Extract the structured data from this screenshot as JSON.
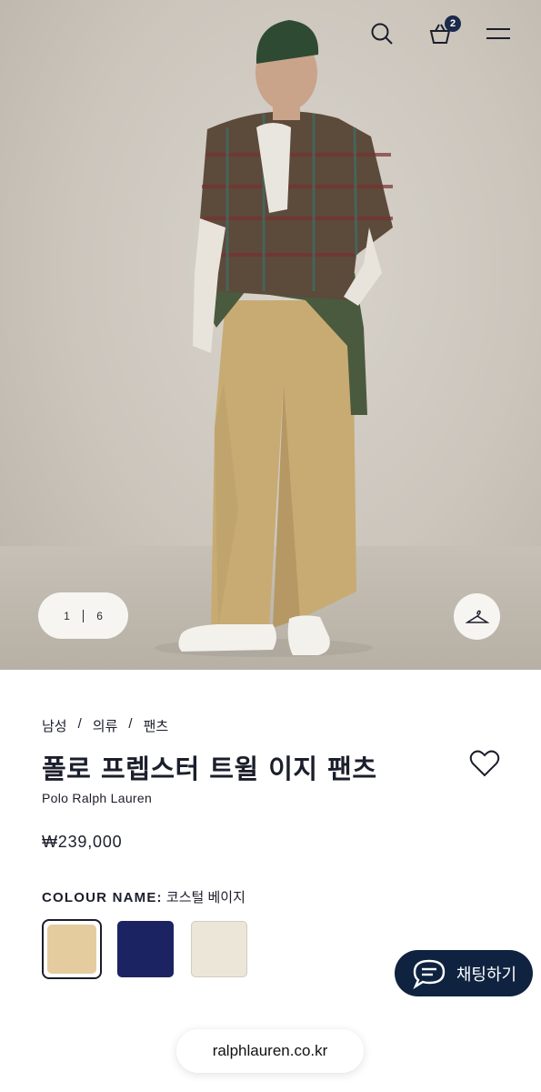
{
  "header": {
    "cart_count": "2"
  },
  "gallery": {
    "current": "1",
    "total": "6"
  },
  "breadcrumb": [
    "남성",
    "의류",
    "팬츠"
  ],
  "product": {
    "title": "폴로 프렙스터 트윌 이지 팬츠",
    "brand": "Polo Ralph Lauren",
    "price": "₩239,000",
    "colour_label": "COLOUR NAME:",
    "colour_value": "코스털 베이지"
  },
  "swatches": [
    {
      "name": "beige",
      "color": "#e4cc9f",
      "selected": true
    },
    {
      "name": "navy",
      "color": "#1c2362",
      "selected": false
    },
    {
      "name": "cream",
      "color": "#ece6d8",
      "selected": false
    }
  ],
  "chat": {
    "label": "채팅하기"
  },
  "browser": {
    "url": "ralphlauren.co.kr"
  },
  "colors": {
    "navy": "#0f2340",
    "text": "#1b1e2b"
  }
}
